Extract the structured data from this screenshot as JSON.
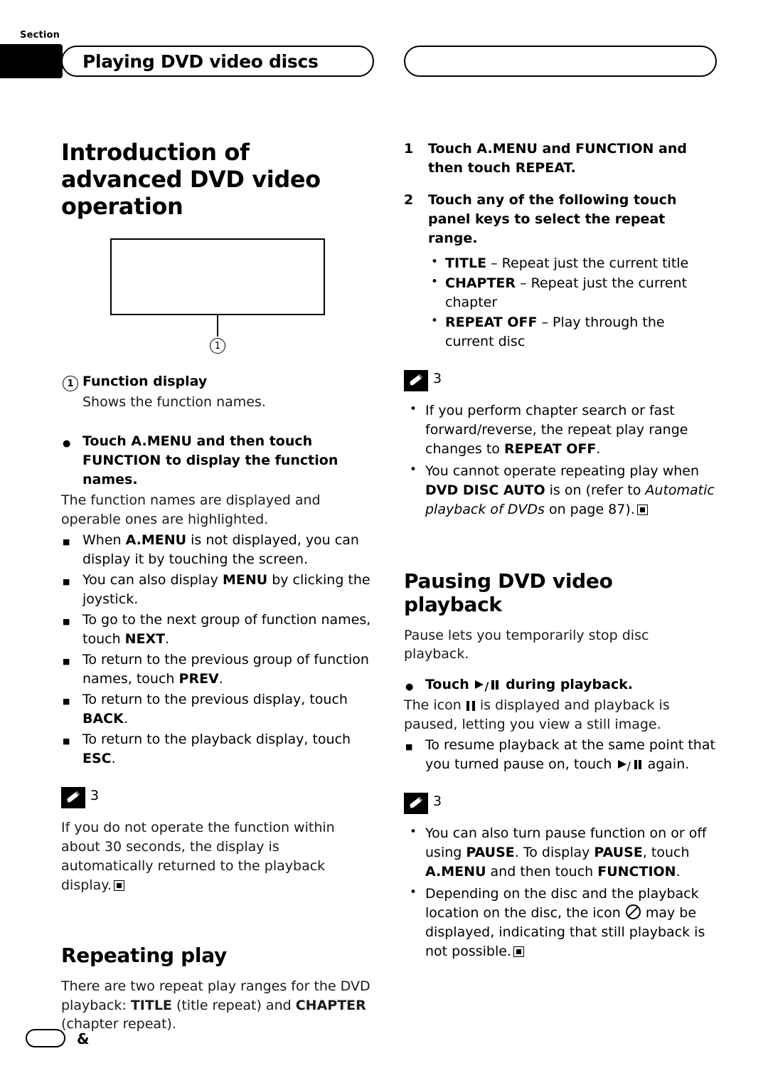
{
  "header": {
    "section_label": "Section",
    "title": "Playing DVD video discs"
  },
  "footer": {
    "page_number": "&"
  },
  "left_column": {
    "heading": "Introduction of advanced DVD video operation",
    "figure": {
      "callout_number": "1"
    },
    "callout_title_number": "1",
    "callout_title": "Function display",
    "callout_desc": "Shows the function names.",
    "instruction": "Touch A.MENU and then touch FUNCTION to display the function names.",
    "instruction_body": "The function names are displayed and operable ones are highlighted.",
    "square_items": [
      "When A.MENU is not displayed, you can display it by touching the screen.",
      "You can also display MENU by clicking the joystick.",
      "To go to the next group of function names, touch NEXT.",
      "To return to the previous group of function names, touch PREV.",
      "To return to the previous display, touch BACK.",
      "To return to the playback display, touch ESC."
    ],
    "note": {
      "number": "3",
      "text": "If you do not operate the function within about 30 seconds, the display is automatically returned to the playback display."
    },
    "repeat_heading": "Repeating play",
    "repeat_body": "There are two repeat play ranges for the DVD playback: TITLE (title repeat) and CHAPTER (chapter repeat)."
  },
  "right_column": {
    "step1_number": "1",
    "step1": "Touch A.MENU and FUNCTION and then touch REPEAT.",
    "step2_number": "2",
    "step2": "Touch any of the following touch panel keys to select the repeat range.",
    "repeat_options": [
      {
        "key": "TITLE",
        "desc": "– Repeat just the current title"
      },
      {
        "key": "CHAPTER",
        "desc": "– Repeat just the current chapter"
      },
      {
        "key": "REPEAT OFF",
        "desc": "– Play through the current disc"
      }
    ],
    "note1": {
      "number": "3",
      "bullet1_part1": "If you perform chapter search or fast forward/reverse, the repeat play range changes to ",
      "bullet1_bold": "REPEAT OFF",
      "bullet1_part2": ".",
      "bullet2_part1": "You cannot operate repeating play when ",
      "bullet2_bold": "DVD DISC AUTO",
      "bullet2_part2": " is on (refer to ",
      "bullet2_italic": "Automatic playback of DVDs",
      "bullet2_part3": " on page 87)."
    },
    "pause_heading": "Pausing DVD video playback",
    "pause_body": "Pause lets you temporarily stop disc playback.",
    "pause_instruction_pre": "Touch",
    "pause_instruction_post": "during playback.",
    "pause_desc_pre": "The icon",
    "pause_desc_post": "is displayed and playback is paused, letting you view a still image.",
    "pause_resume_pre": "To resume playback at the same point that you turned pause on, touch",
    "pause_resume_post": "again.",
    "note2": {
      "number": "3",
      "bullet1_part1": "You can also turn pause function on or off using ",
      "bullet1_b1": "PAUSE",
      "bullet1_part2": ". To display ",
      "bullet1_b2": "PAUSE",
      "bullet1_part3": ", touch ",
      "bullet1_b3": "A.MENU",
      "bullet1_part4": " and then touch ",
      "bullet1_b4": "FUNCTION",
      "bullet1_part5": ".",
      "bullet2_part1": "Depending on the disc and the playback location on the disc, the icon",
      "bullet2_part2": "may be displayed, indicating that still playback is not possible."
    }
  }
}
